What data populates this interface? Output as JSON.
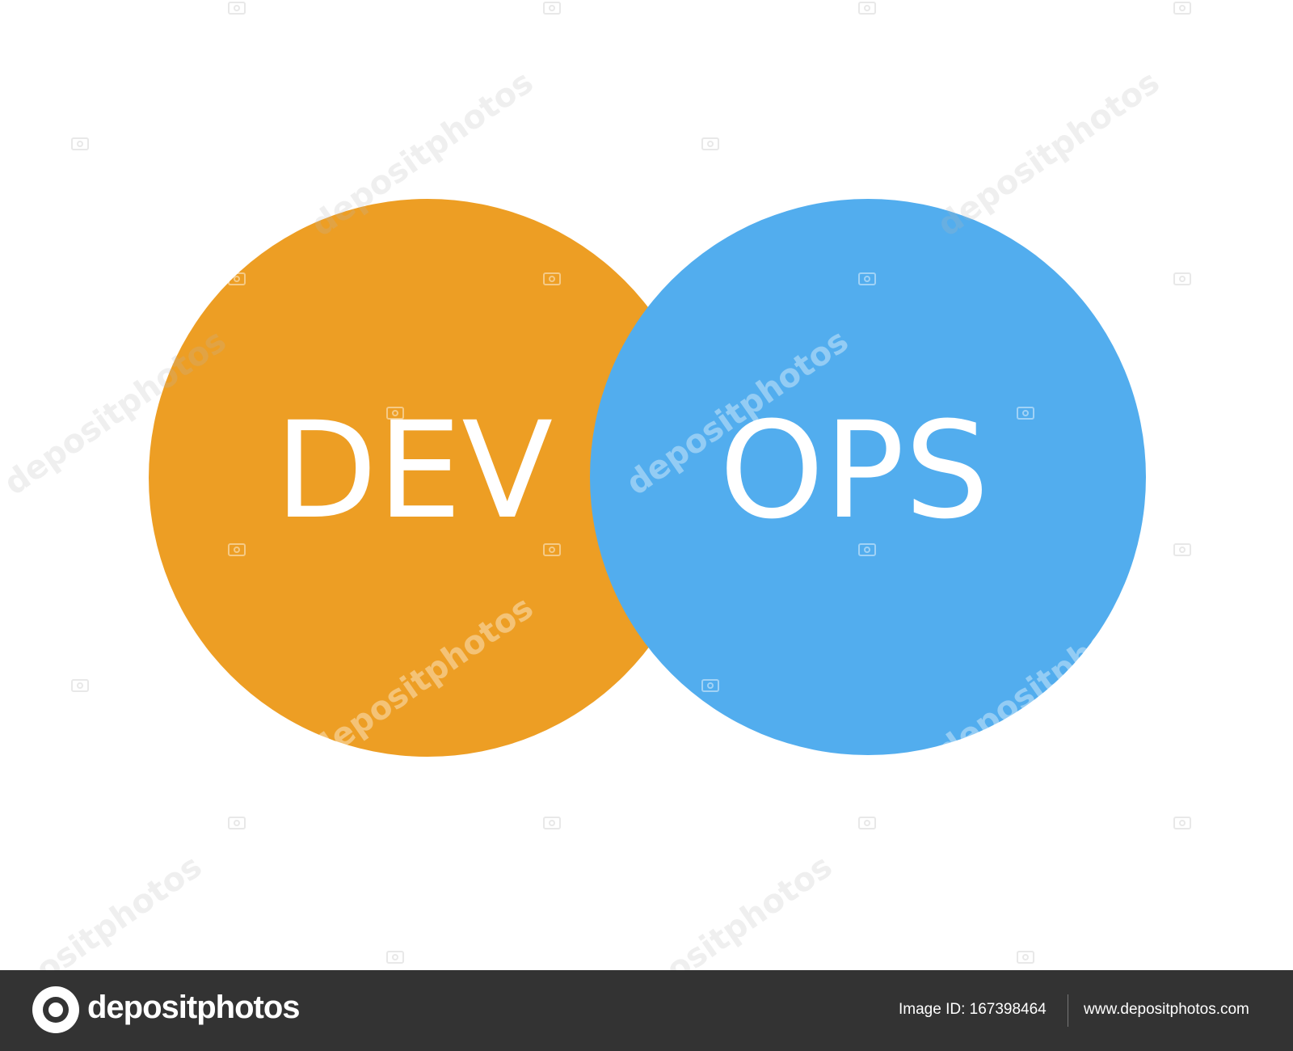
{
  "graphic": {
    "dev_label": "DEV",
    "ops_label": "OPS",
    "colors": {
      "dev": "#ed9e24",
      "ops": "#52adee",
      "label": "#ffffff",
      "background": "#ffffff"
    }
  },
  "watermark": {
    "text": "depositphotos",
    "icon": "camera-icon"
  },
  "footer": {
    "brand": "depositphotos",
    "logo_icon": "depositphotos-logo-icon",
    "image_id": "Image ID: 167398464",
    "url": "www.depositphotos.com",
    "background": "#333333"
  }
}
